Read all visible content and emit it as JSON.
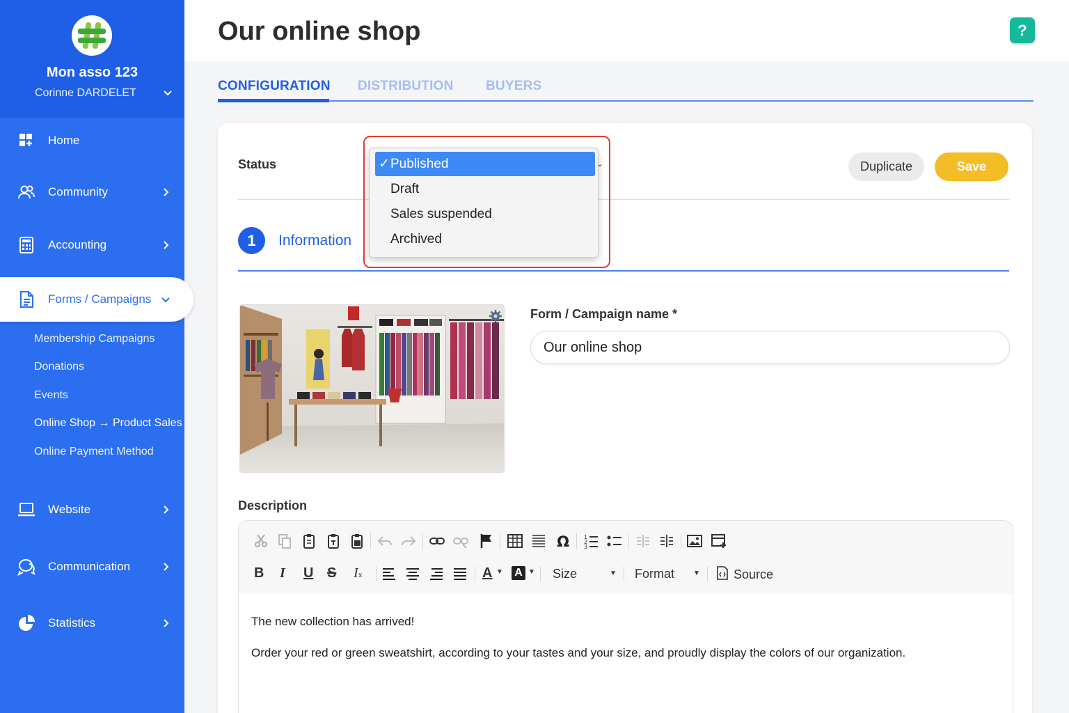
{
  "sidebar": {
    "org_name": "Mon asso 123",
    "user_name": "Corinne DARDELET",
    "items": [
      {
        "label": "Home"
      },
      {
        "label": "Community"
      },
      {
        "label": "Accounting"
      },
      {
        "label": "Forms / Campaigns"
      },
      {
        "label": "Website"
      },
      {
        "label": "Communication"
      },
      {
        "label": "Statistics"
      }
    ],
    "sub_items": [
      {
        "label": "Membership Campaigns"
      },
      {
        "label": "Donations"
      },
      {
        "label": "Events"
      },
      {
        "label": "Online Shop → Product Sales"
      },
      {
        "label": "Online Payment Method"
      }
    ]
  },
  "header": {
    "title": "Our online shop",
    "help_label": "?"
  },
  "tabs": [
    {
      "label": "CONFIGURATION",
      "active": true
    },
    {
      "label": "DISTRIBUTION",
      "active": false
    },
    {
      "label": "BUYERS",
      "active": false
    }
  ],
  "status": {
    "label": "Status",
    "options": [
      "Published",
      "Draft",
      "Sales suspended",
      "Archived"
    ],
    "selected": "Published",
    "check": "✓"
  },
  "actions": {
    "duplicate_label": "Duplicate",
    "save_label": "Save"
  },
  "step": {
    "number": "1",
    "label": "Information"
  },
  "form": {
    "name_label": "Form / Campaign name *",
    "name_value": "Our online shop",
    "description_label": "Description"
  },
  "toolbar": {
    "size_label": "Size",
    "format_label": "Format",
    "source_label": "Source"
  },
  "description": {
    "line1": "The new collection has arrived!",
    "line2": "Order your red or green sweatshirt, according to your tastes and your size, and proudly display the colors of our organization."
  },
  "colors": {
    "sidebar": "#2b6ef0",
    "accent": "#1f5fe6",
    "save": "#f5bd25",
    "help": "#15b99a",
    "highlight": "#e8382e"
  }
}
